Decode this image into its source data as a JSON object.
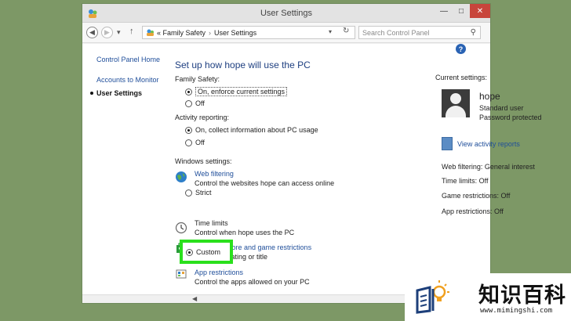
{
  "window": {
    "title": "User Settings",
    "controls": {
      "minimize": "—",
      "maximize": "□",
      "close": "✕"
    }
  },
  "navbar": {
    "back_icon": "arrow-left-icon",
    "forward_icon": "arrow-right-icon",
    "history_icon": "chevron-down-icon",
    "up_icon": "arrow-up-icon",
    "breadcrumb_prefix": "«",
    "breadcrumb": [
      "Family Safety",
      "User Settings"
    ],
    "breadcrumb_sep": "›",
    "refresh_icon": "refresh-icon",
    "search_placeholder": "Search Control Panel"
  },
  "sidebar": {
    "items": [
      {
        "label": "Control Panel Home"
      },
      {
        "label": "Accounts to Monitor"
      },
      {
        "label": "User Settings",
        "current": true
      }
    ]
  },
  "main": {
    "title": "Set up how hope will use the PC",
    "family_safety": {
      "label": "Family Safety:",
      "options": [
        "On, enforce current settings",
        "Off"
      ],
      "selected": "On, enforce current settings"
    },
    "activity_reporting": {
      "label": "Activity reporting:",
      "options": [
        "On, collect information about PC usage",
        "Off"
      ],
      "selected": "On, collect information about PC usage"
    },
    "windows_settings": {
      "label": "Windows settings:",
      "web_filtering": {
        "link": "Web filtering",
        "desc": "Control the websites hope can access online",
        "options": [
          "Strict",
          "Custom"
        ],
        "selected": "Custom"
      },
      "time_limits": {
        "link": "Time limits",
        "desc": "Control when hope uses the PC"
      },
      "store_games": {
        "link": "Windows Store and game restrictions",
        "desc": "Control by rating or title"
      },
      "app_restrictions": {
        "link": "App restrictions",
        "desc": "Control the apps allowed on your PC"
      }
    }
  },
  "current_settings": {
    "title": "Current settings:",
    "user": {
      "name": "hope",
      "type": "Standard user",
      "password": "Password protected"
    },
    "report_link": "View activity reports",
    "rows": [
      "Web filtering: General interest",
      "Time limits: Off",
      "Game restrictions: Off",
      "App restrictions: Off"
    ]
  },
  "help_icon": "?",
  "highlight_color": "#2ae01c",
  "watermark": {
    "text": "知识百科",
    "url": "www.mimingshi.com"
  }
}
